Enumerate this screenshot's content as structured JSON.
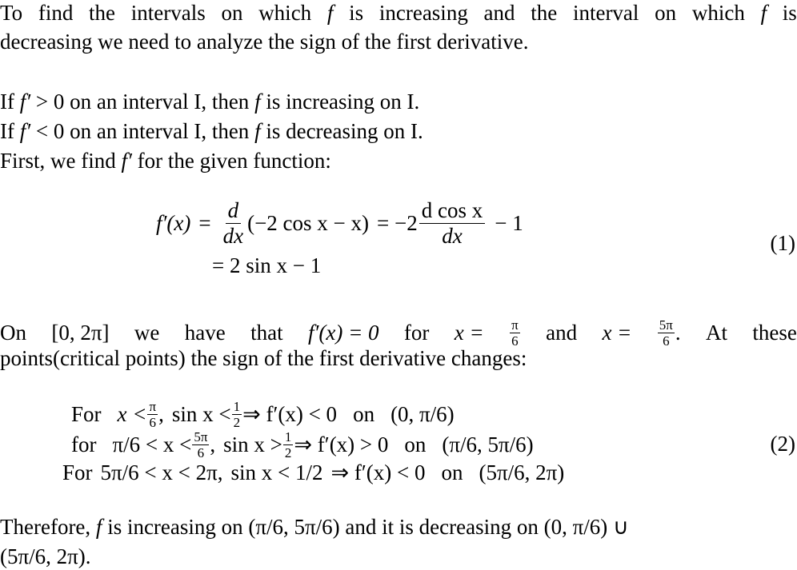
{
  "intro": {
    "line1_words": [
      "To",
      "find",
      "the",
      "intervals",
      "on",
      "which",
      "f",
      "is",
      "increasing",
      "and",
      "the",
      "interval",
      "on",
      "which",
      "f",
      "is"
    ],
    "line2": "decreasing we need to analyze the sign of the first derivative."
  },
  "rules": {
    "rule1": {
      "a": "If ",
      "f": "f′",
      "b": " > 0 on an interval I, then ",
      "f2": "f",
      "c": " is increasing on I."
    },
    "rule2": {
      "a": "If ",
      "f": "f′",
      "b": " < 0 on an interval I, then ",
      "f2": "f",
      "c": " is decreasing on I."
    },
    "first": {
      "a": "First, we find ",
      "f": "f′",
      "b": " for the given function:"
    }
  },
  "equation1": {
    "lhs": "f′(x)",
    "eq": "=",
    "d_num": "d",
    "d_den": "dx",
    "paren": "(−2 cos x − x)",
    "eq2": "= −2",
    "frac2_num": "d cos x",
    "frac2_den": "dx",
    "tail": "− 1",
    "line2": "= 2 sin x − 1",
    "number": "(1)"
  },
  "critical": {
    "line1_parts": [
      "On",
      "[0, 2π]",
      "we",
      "have",
      "that",
      "f′(x) = 0",
      "for",
      "x =",
      "π/6",
      "and",
      "x =",
      "5π/6.",
      "At",
      "these"
    ],
    "on": "On [0, 2π] we have that ",
    "fx": "f′(x) = 0",
    "for": "for",
    "x_eq": "x = ",
    "pi": "π",
    "six": "6",
    "and": " and ",
    "x_eq2": "x = ",
    "fivepi": "5π",
    "at_these": ".  At these",
    "line2": "points(critical points) the sign of the first derivative changes:"
  },
  "equation2": {
    "rows": [
      {
        "label": "For",
        "cond_pre": "x < ",
        "cond_frac_num": "π",
        "cond_frac_den": "6",
        "cond_post": ",",
        "sin": "sin x < ",
        "sin_frac_num": "1",
        "sin_frac_den": "2",
        "implies": "⇒ f′(x) < 0",
        "on": "on",
        "interval": "(0, π/6)"
      },
      {
        "label": "for",
        "cond_pre": "π/6 < x < ",
        "cond_frac_num": "5π",
        "cond_frac_den": "6",
        "cond_post": ",",
        "sin": "sin x > ",
        "sin_frac_num": "1",
        "sin_frac_den": "2",
        "implies": "⇒ f′(x) > 0",
        "on": "on",
        "interval": "(π/6, 5π/6)"
      },
      {
        "label": "For",
        "cond_text": "5π/6 < x < 2π,",
        "sin_text": "sin x < 1/2",
        "implies": "⇒ f′(x) < 0",
        "on": "on",
        "interval": "(5π/6, 2π)"
      }
    ],
    "number": "(2)"
  },
  "conclusion": {
    "line1": "Therefore, f is increasing on (π/6, 5π/6) and it is decreasing on (0, π/6) ∪",
    "a": "Therefore,",
    "f": "f",
    "b": "is increasing on (π/6, 5π/6) and it is decreasing on (0, π/6) ∪",
    "line2": "(5π/6, 2π)."
  }
}
